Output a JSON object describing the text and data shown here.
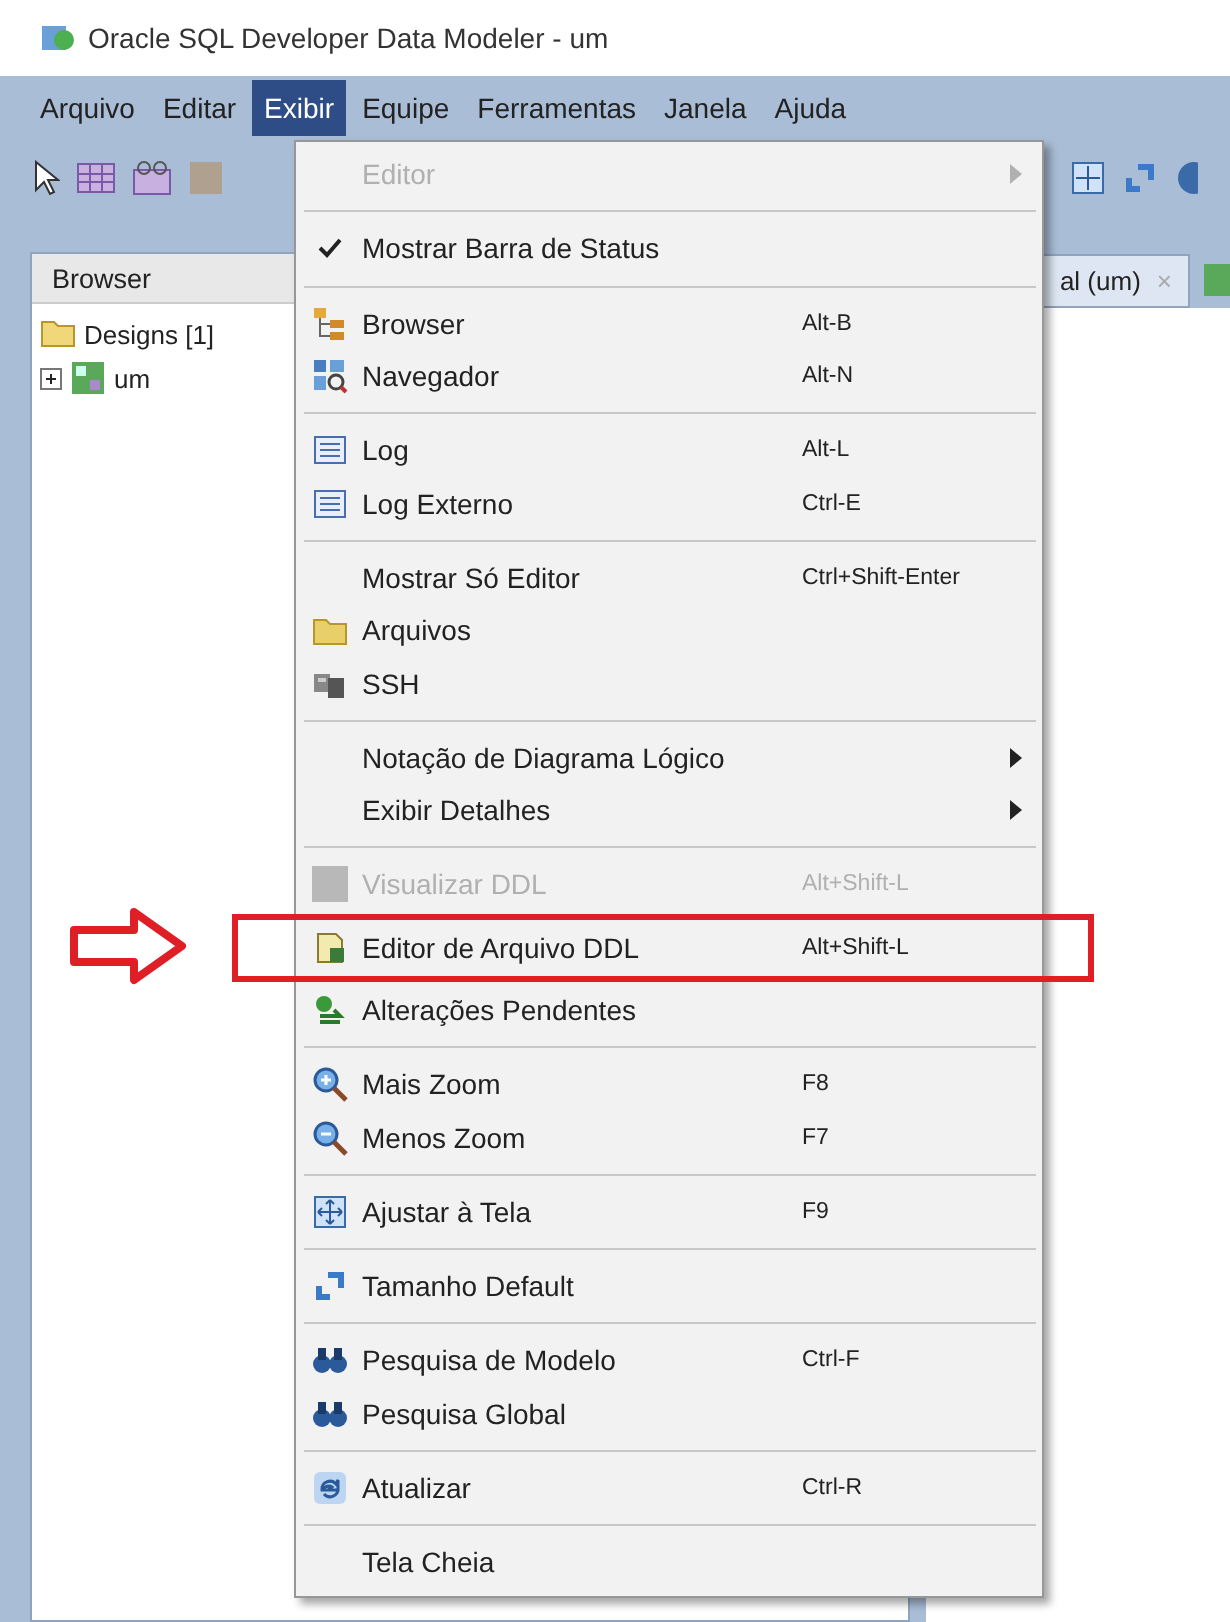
{
  "window": {
    "title": "Oracle SQL Developer Data Modeler - um"
  },
  "menubar": [
    {
      "label": "Arquivo",
      "selected": false
    },
    {
      "label": "Editar",
      "selected": false
    },
    {
      "label": "Exibir",
      "selected": true
    },
    {
      "label": "Equipe",
      "selected": false
    },
    {
      "label": "Ferramentas",
      "selected": false
    },
    {
      "label": "Janela",
      "selected": false
    },
    {
      "label": "Ajuda",
      "selected": false
    }
  ],
  "browser_panel": {
    "tab": "Browser",
    "tree": [
      {
        "label": "Designs [1]",
        "expanded": true,
        "children": [
          {
            "label": "um",
            "expanded": false
          }
        ]
      }
    ]
  },
  "editor_tab": {
    "label": "al (um)",
    "close": "×"
  },
  "menu": {
    "groups": [
      [
        {
          "label": "Editor",
          "kind": "none",
          "disabled": true,
          "checked": false,
          "submenu": true,
          "framed": false
        }
      ],
      [
        {
          "label": "Mostrar Barra de Status",
          "kind": "none",
          "disabled": false,
          "checked": true,
          "submenu": false,
          "framed": false
        }
      ],
      [
        {
          "label": "Browser",
          "kind": "tree",
          "shortcut": "Alt-B",
          "disabled": false,
          "checked": false,
          "submenu": false,
          "framed": false
        },
        {
          "label": "Navegador",
          "kind": "navigator",
          "shortcut": "Alt-N",
          "disabled": false,
          "checked": false,
          "submenu": false,
          "framed": false
        }
      ],
      [
        {
          "label": "Log",
          "kind": "log",
          "shortcut": "Alt-L",
          "disabled": false,
          "checked": false,
          "submenu": false,
          "framed": false
        },
        {
          "label": "Log Externo",
          "kind": "log",
          "shortcut": "Ctrl-E",
          "disabled": false,
          "checked": false,
          "submenu": false,
          "framed": false
        }
      ],
      [
        {
          "label": "Mostrar Só Editor",
          "kind": "none",
          "shortcut": "Ctrl+Shift-Enter",
          "disabled": false,
          "checked": false,
          "submenu": false,
          "framed": false
        },
        {
          "label": "Arquivos",
          "kind": "folder",
          "disabled": false,
          "checked": false,
          "submenu": false,
          "framed": false
        },
        {
          "label": "SSH",
          "kind": "ssh",
          "disabled": false,
          "checked": false,
          "submenu": false,
          "framed": false
        }
      ],
      [
        {
          "label": "Notação de Diagrama Lógico",
          "kind": "none",
          "disabled": false,
          "checked": false,
          "submenu": true,
          "framed": false
        },
        {
          "label": "Exibir Detalhes",
          "kind": "none",
          "disabled": false,
          "checked": false,
          "submenu": true,
          "framed": false
        }
      ],
      [
        {
          "label": "Visualizar DDL",
          "kind": "grey",
          "shortcut": "Alt+Shift-L",
          "disabled": true,
          "checked": false,
          "submenu": false,
          "framed": false
        },
        {
          "label": "Editor de Arquivo DDL",
          "kind": "ddl",
          "shortcut": "Alt+Shift-L",
          "disabled": false,
          "checked": false,
          "submenu": false,
          "framed": true
        },
        {
          "label": "Alterações Pendentes",
          "kind": "changes",
          "disabled": false,
          "checked": false,
          "submenu": false,
          "framed": false
        }
      ],
      [
        {
          "label": "Mais Zoom",
          "kind": "zoom-in",
          "shortcut": "F8",
          "disabled": false,
          "checked": false,
          "submenu": false,
          "framed": false
        },
        {
          "label": "Menos Zoom",
          "kind": "zoom-out",
          "shortcut": "F7",
          "disabled": false,
          "checked": false,
          "submenu": false,
          "framed": false
        }
      ],
      [
        {
          "label": "Ajustar à Tela",
          "kind": "fit",
          "shortcut": "F9",
          "disabled": false,
          "checked": false,
          "submenu": false,
          "framed": false
        }
      ],
      [
        {
          "label": "Tamanho Default",
          "kind": "resize",
          "disabled": false,
          "checked": false,
          "submenu": false,
          "framed": false
        }
      ],
      [
        {
          "label": "Pesquisa de Modelo",
          "kind": "binoculars",
          "shortcut": "Ctrl-F",
          "disabled": false,
          "checked": false,
          "submenu": false,
          "framed": false
        },
        {
          "label": "Pesquisa Global",
          "kind": "binoculars",
          "disabled": false,
          "checked": false,
          "submenu": false,
          "framed": false
        }
      ],
      [
        {
          "label": "Atualizar",
          "kind": "refresh",
          "shortcut": "Ctrl-R",
          "disabled": false,
          "checked": false,
          "submenu": false,
          "framed": false
        }
      ],
      [
        {
          "label": "Tela Cheia",
          "kind": "none",
          "disabled": false,
          "checked": false,
          "submenu": false,
          "framed": false
        }
      ]
    ]
  }
}
